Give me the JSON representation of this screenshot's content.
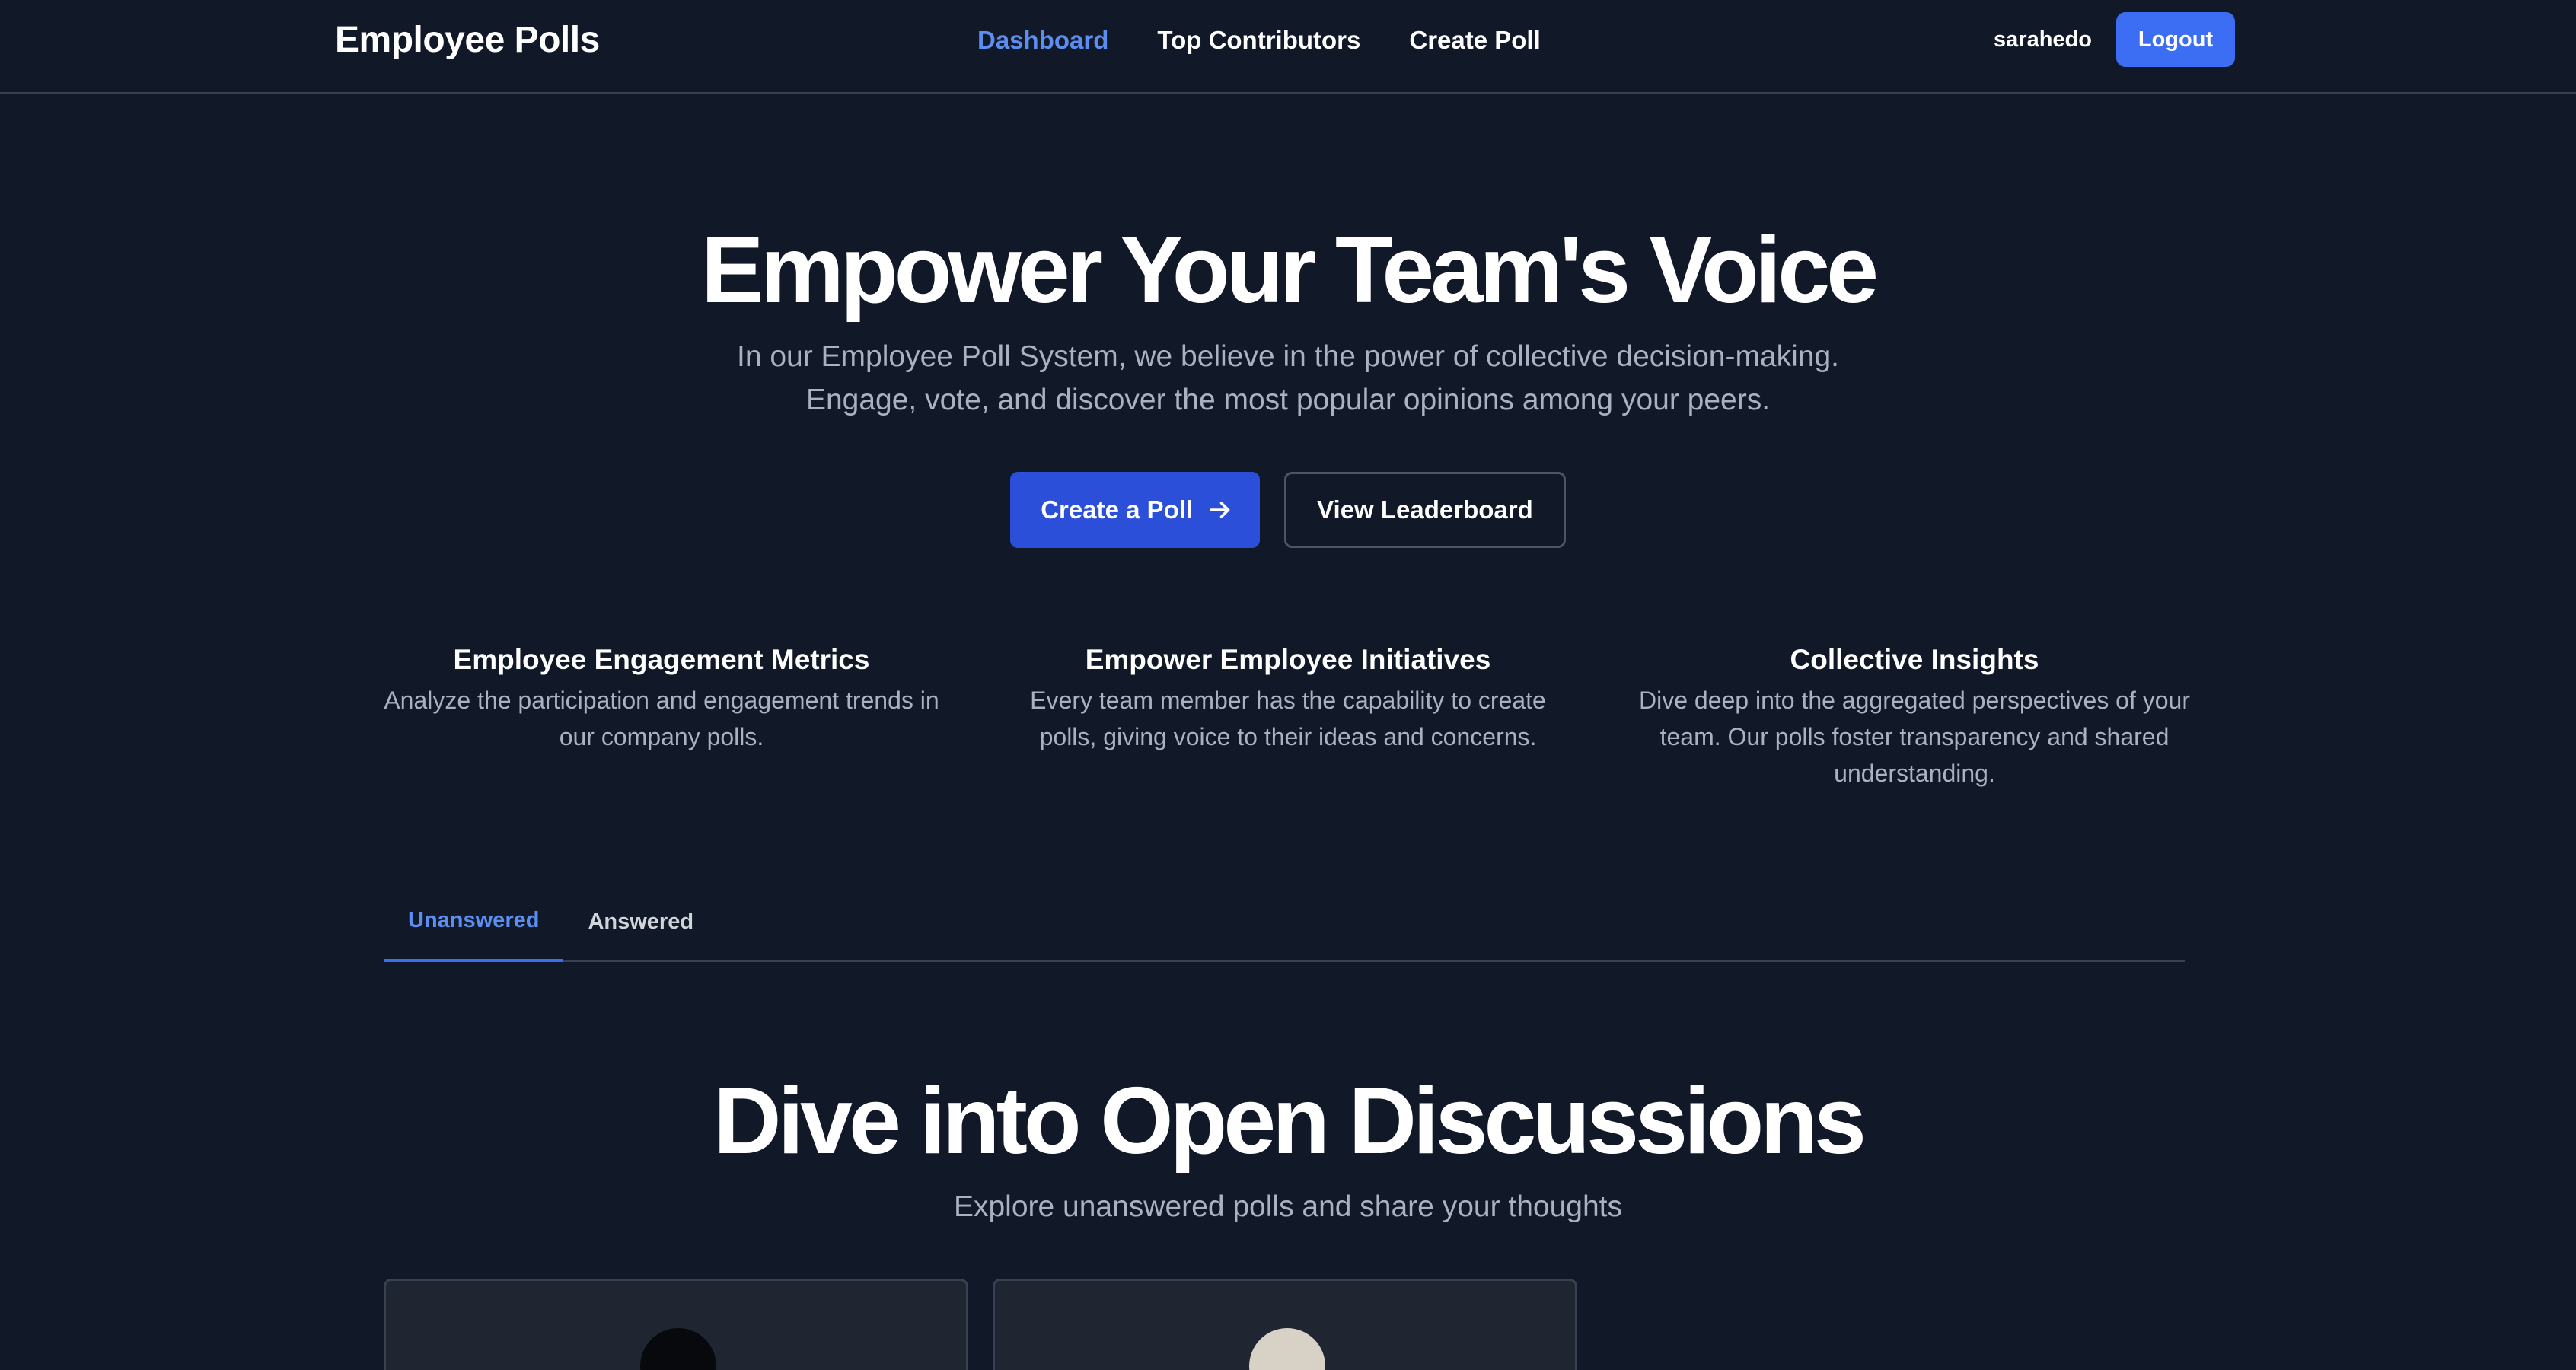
{
  "header": {
    "brand": "Employee Polls",
    "nav": [
      {
        "label": "Dashboard",
        "active": true
      },
      {
        "label": "Top Contributors",
        "active": false
      },
      {
        "label": "Create Poll",
        "active": false
      }
    ],
    "username": "sarahedo",
    "logout_label": "Logout"
  },
  "hero": {
    "title": "Empower Your Team's Voice",
    "subtitle": "In our Employee Poll System, we believe in the power of collective decision-making. Engage, vote, and discover the most popular opinions among your peers.",
    "primary_button": "Create a Poll",
    "primary_button_icon": "arrow-right-icon",
    "secondary_button": "View Leaderboard"
  },
  "features": [
    {
      "title": "Employee Engagement Metrics",
      "description": "Analyze the participation and engagement trends in our company polls."
    },
    {
      "title": "Empower Employee Initiatives",
      "description": "Every team member has the capability to create polls, giving voice to their ideas and concerns."
    },
    {
      "title": "Collective Insights",
      "description": "Dive deep into the aggregated perspectives of your team. Our polls foster transparency and shared understanding."
    }
  ],
  "tabs": [
    {
      "label": "Unanswered",
      "active": true
    },
    {
      "label": "Answered",
      "active": false
    }
  ],
  "section": {
    "title": "Dive into Open Discussions",
    "subtitle": "Explore unanswered polls and share your thoughts"
  },
  "colors": {
    "background": "#111827",
    "accent": "#3b6ef2",
    "active_link": "#5b8ef0",
    "muted_text": "#aab2c0",
    "border": "#374151",
    "card": "#1f2531"
  }
}
